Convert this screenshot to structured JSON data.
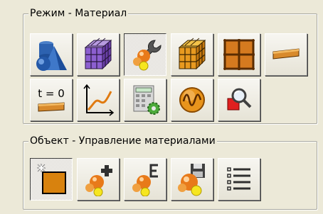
{
  "groups": {
    "mode": {
      "title": "Режим - Материал",
      "buttons": [
        {
          "name": "primitives-button",
          "icon": "shapes-icon",
          "pressed": false
        },
        {
          "name": "volume-grid-button",
          "icon": "purple-cube-icon",
          "pressed": false
        },
        {
          "name": "material-tools-button",
          "icon": "wrench-atom-icon",
          "pressed": true
        },
        {
          "name": "orange-cube-grid-button",
          "icon": "orange-cube-icon",
          "pressed": false
        },
        {
          "name": "grid-tile-button",
          "icon": "tile-grid-icon",
          "pressed": false
        },
        {
          "name": "plank-button",
          "icon": "plank-icon",
          "pressed": false
        },
        {
          "name": "time-zero-button",
          "icon": "time-zero-icon",
          "label": "t = 0",
          "pressed": false
        },
        {
          "name": "curve-chart-button",
          "icon": "curve-chart-icon",
          "pressed": false
        },
        {
          "name": "calculator-button",
          "icon": "calculator-gear-icon",
          "pressed": false
        },
        {
          "name": "wave-button",
          "icon": "wave-icon",
          "pressed": false
        },
        {
          "name": "inspect-button",
          "icon": "magnifier-icon",
          "pressed": false
        }
      ]
    },
    "object": {
      "title": "Объект - Управление материалами",
      "buttons": [
        {
          "name": "new-material-button",
          "icon": "new-material-icon",
          "pressed": true
        },
        {
          "name": "add-material-button",
          "icon": "atom-plus-icon",
          "pressed": false
        },
        {
          "name": "edit-material-button",
          "icon": "atom-e-icon",
          "pressed": false
        },
        {
          "name": "save-material-button",
          "icon": "atom-save-icon",
          "pressed": false
        },
        {
          "name": "material-list-button",
          "icon": "list-icon",
          "pressed": false
        }
      ]
    }
  }
}
